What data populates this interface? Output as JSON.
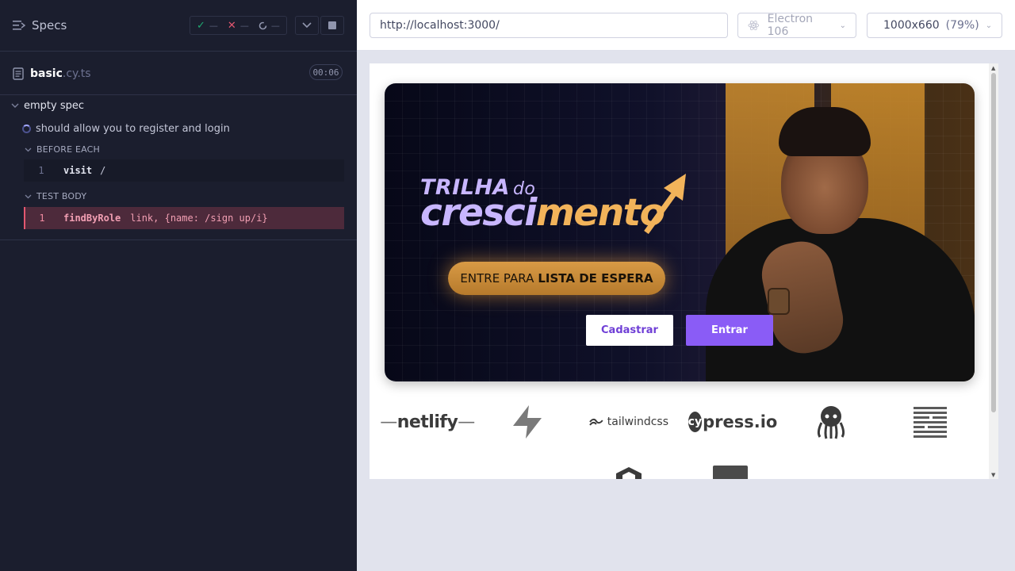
{
  "reporter": {
    "title": "Specs",
    "stats": {
      "passed": "—",
      "failed": "—",
      "pending": "—"
    },
    "spec": {
      "name": "basic",
      "ext": ".cy.ts",
      "duration": "00:06"
    },
    "suite": "empty spec",
    "test": "should allow you to register and login",
    "hooks": [
      {
        "label": "BEFORE EACH",
        "commands": [
          {
            "num": "1",
            "name": "visit",
            "arg": "/"
          }
        ]
      },
      {
        "label": "TEST BODY",
        "commands": [
          {
            "num": "1",
            "name": "findByRole",
            "arg": "link, {name: /sign up/i}"
          }
        ]
      }
    ]
  },
  "browser": {
    "url": "http://localhost:3000/",
    "browser_name": "Electron 106",
    "viewport": "1000x660",
    "zoom": "(79%)"
  },
  "page": {
    "hero": {
      "title_line1": "TRILHA",
      "title_do": "do",
      "title_line2_a": "cresci",
      "title_line2_b": "mento",
      "cta_prefix": "ENTRE PARA",
      "cta_bold": "LISTA DE ESPERA"
    },
    "buttons": {
      "register": "Cadastrar",
      "login": "Entrar"
    },
    "logos": {
      "netlify": "netlify",
      "tailwind": "tailwindcss",
      "cypress_badge": "cy",
      "cypress_rest": "press.io"
    }
  },
  "colors": {
    "accent": "#8a5cf6",
    "fail": "#e45770",
    "pass": "#1fa971",
    "reporter_bg": "#1b1e2e"
  }
}
